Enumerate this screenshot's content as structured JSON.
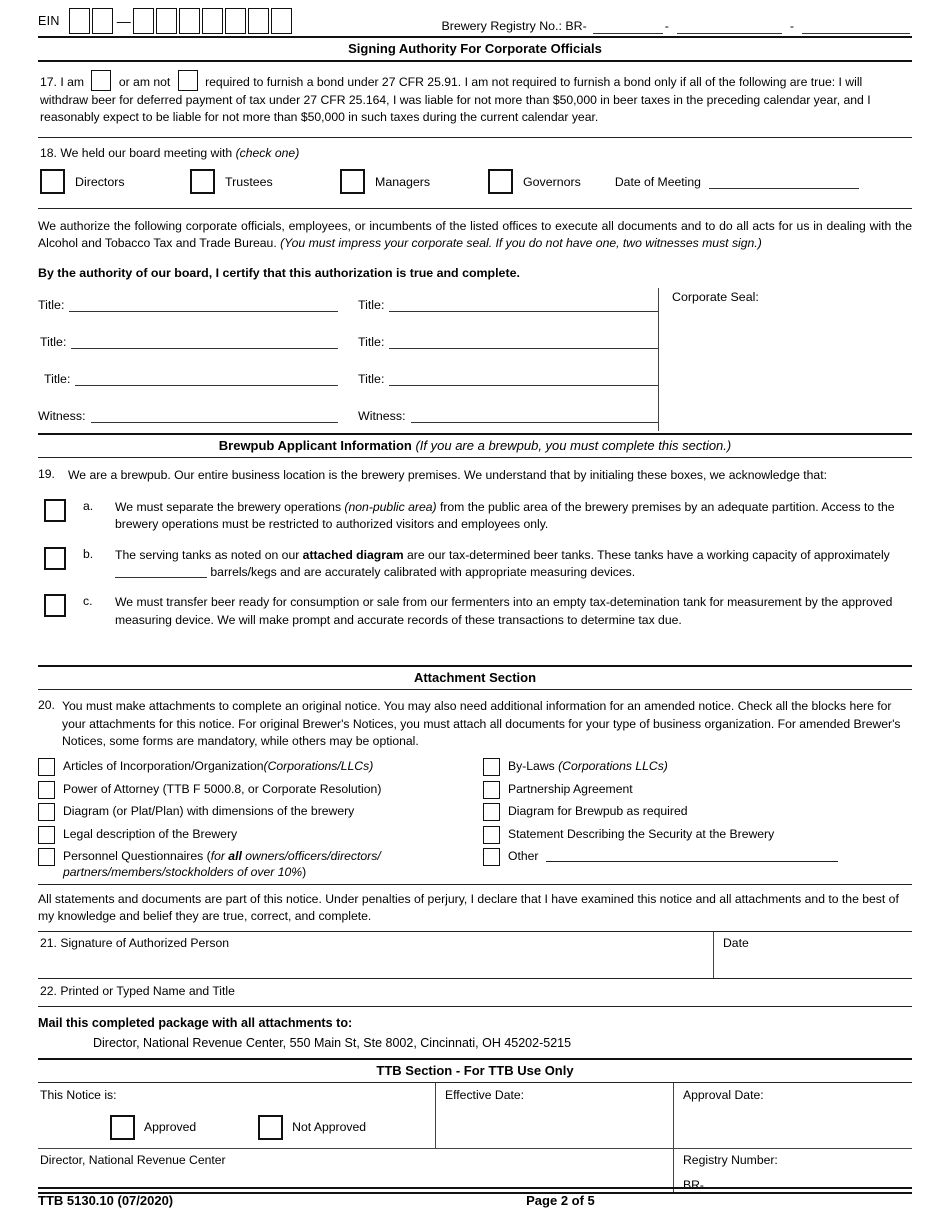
{
  "header": {
    "ein_label": "EIN",
    "ein_boxes_group1": 2,
    "ein_boxes_group2": 7,
    "ein_dash": "—",
    "registry_label": "Brewery Registry No.: BR-",
    "registry_sep1": "-",
    "registry_sep2": "-"
  },
  "section_signing": {
    "band_title": "Signing Authority For Corporate Officials"
  },
  "item17": {
    "number": "17.",
    "lead": "I am",
    "mid": "or am not",
    "body": "required to furnish a bond under 27 CFR 25.91.  I am not required to furnish a bond only if all of the following are true: I will withdraw beer for deferred payment of tax under 27 CFR 25.164, I was liable for not more than $50,000 in beer taxes in the preceding calendar year, and I reasonably expect to be liable for not more than $50,000 in such taxes during the current calendar year."
  },
  "item18": {
    "number": "18.",
    "title": "We held our board meeting with",
    "title_italic": "(check one)",
    "options": [
      {
        "label": "Directors"
      },
      {
        "label": "Trustees"
      },
      {
        "label": "Managers"
      },
      {
        "label": "Governors"
      }
    ],
    "date_label": "Date of Meeting"
  },
  "authorize": {
    "paragraph": "We authorize the following corporate officials, employees, or incumbents of the listed offices to execute all documents and to do all acts for us in dealing with the Alcohol and Tobacco Tax and Trade Bureau.",
    "paragraph_italic": "(You must impress your corporate seal.  If you do not have one,  two witnesses must sign.)",
    "certify": "By the authority of our board, I certify that this authorization is true and complete."
  },
  "titles_block": {
    "seal_label": "Corporate Seal:",
    "rows": [
      {
        "left_label": "Title:",
        "right_label": "Title:"
      },
      {
        "left_label": "Title:",
        "right_label": "Title:"
      },
      {
        "left_label": "Title:",
        "right_label": "Title:"
      },
      {
        "left_label": "Witness:",
        "right_label": "Witness:"
      }
    ]
  },
  "section_brewpub": {
    "band_title": "Brewpub Applicant Information",
    "band_italic": "(If you are a brewpub, you must complete this section.)",
    "item19_number": "19.",
    "item19_text": "We are a brewpub.  Our entire business location is the brewery premises.  We understand that by initialing these boxes, we acknowledge that:",
    "items": [
      {
        "letter": "a.",
        "text_1": "We must separate the brewery operations ",
        "text_italic": "(non-public area)",
        "text_2": " from the public area of the brewery premises by an adequate partition. Access to the brewery operations must be restricted to authorized visitors and employees only."
      },
      {
        "letter": "b.",
        "text_1": "The serving tanks as noted on our ",
        "text_bold": "attached diagram",
        "text_2": " are our tax-determined beer tanks.  These tanks have a working capacity of approximately",
        "text_3": "barrels/kegs and are accurately calibrated with appropriate measuring devices."
      },
      {
        "letter": "c.",
        "text_1": "We must transfer beer ready for consumption or sale from our fermenters into an empty tax-detemination tank for measurement by the approved measuring device.  We will make prompt and accurate records of these transactions to determine tax due."
      }
    ]
  },
  "section_attachment": {
    "band_title": "Attachment Section",
    "item20_number": "20.",
    "item20_text": "You must make attachments to complete an original notice.  You may also need additional information for an amended notice. Check all the blocks here for your attachments for this notice.  For original Brewer's Notices, you must attach all documents for your type of business organization.  For amended Brewer's Notices, some forms are mandatory, while others may be optional.",
    "left_items": [
      {
        "label": "Articles of Incorporation/Organization",
        "label_italic": "(Corporations/LLCs)"
      },
      {
        "label": "Power of Attorney (TTB F 5000.8, or Corporate Resolution)"
      },
      {
        "label": "Diagram (or Plat/Plan) with dimensions of the brewery"
      },
      {
        "label": "Legal description of the Brewery"
      },
      {
        "label": "Personnel Questionnaires (",
        "label_italic_pre": "for ",
        "label_bold": "all",
        "label_italic_post": " owners/officers/directors/ partners/members/stockholders of over 10%",
        "label_tail": ")"
      }
    ],
    "right_items": [
      {
        "label": "By-Laws",
        "label_italic": "(Corporations LLCs)"
      },
      {
        "label": "Partnership Agreement"
      },
      {
        "label": "Diagram for Brewpub as required"
      },
      {
        "label": "Statement Describing the Security at the Brewery"
      },
      {
        "label": "Other"
      }
    ]
  },
  "declaration": {
    "text": "All statements and documents are part of this notice.  Under penalties of perjury, I declare that I have examined this notice and all attachments and to the best of my knowledge and belief they are true, correct, and complete."
  },
  "signature": {
    "item21_label": "21. Signature of Authorized Person",
    "date_label": "Date",
    "item22_label": "22. Printed or Typed Name and Title"
  },
  "mail": {
    "heading": "Mail this completed package with all attachments to:",
    "address": "Director, National Revenue Center, 550 Main St, Ste 8002, Cincinnati, OH 45202-5215"
  },
  "ttb_section": {
    "band_title": "TTB Section - For TTB Use Only",
    "notice_label": "This Notice is:",
    "approved_label": "Approved",
    "not_approved_label": "Not Approved",
    "effective_date_label": "Effective Date:",
    "approval_date_label": "Approval Date:",
    "director_label": "Director, National Revenue Center",
    "registry_number_label": "Registry Number:",
    "registry_prefix": "BR-"
  },
  "footer": {
    "form_id": "TTB 5130.10 (07/2020)",
    "page_label": "Page 2 of 5"
  }
}
